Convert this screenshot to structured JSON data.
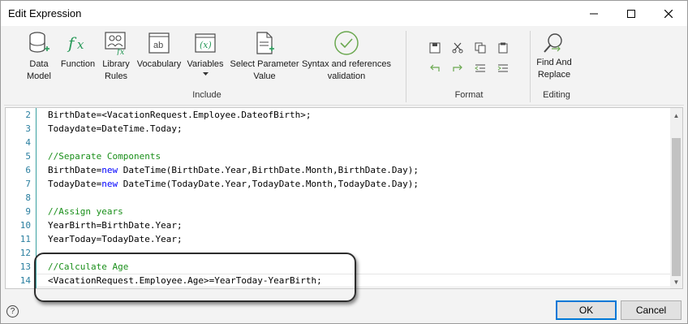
{
  "window": {
    "title": "Edit Expression"
  },
  "ribbon": {
    "include_group": {
      "label": "Include",
      "tools": [
        {
          "label": "Data\nModel"
        },
        {
          "label": "Function"
        },
        {
          "label": "Library\nRules"
        },
        {
          "label": "Vocabulary"
        },
        {
          "label": "Variables"
        },
        {
          "label": "Select Parameter\nValue"
        },
        {
          "label": "Syntax and references\nvalidation"
        }
      ]
    },
    "format_group": {
      "label": "Format"
    },
    "editing_group": {
      "label": "Editing",
      "tools": [
        {
          "label": "Find And\nReplace"
        }
      ]
    }
  },
  "editor": {
    "lines": [
      {
        "n": "2",
        "parts": [
          [
            "BirthDate=<VacationRequest.Employee.DateofBirth>;",
            "n"
          ]
        ]
      },
      {
        "n": "3",
        "parts": [
          [
            "Todaydate=DateTime.Today;",
            "n"
          ]
        ]
      },
      {
        "n": "4",
        "parts": []
      },
      {
        "n": "5",
        "parts": [
          [
            "//Separate Components",
            "c"
          ]
        ]
      },
      {
        "n": "6",
        "parts": [
          [
            "BirthDate=",
            "n"
          ],
          [
            "new",
            "k"
          ],
          [
            " DateTime(BirthDate.Year,BirthDate.Month,BirthDate.Day);",
            "n"
          ]
        ]
      },
      {
        "n": "7",
        "parts": [
          [
            "TodayDate=",
            "n"
          ],
          [
            "new",
            "k"
          ],
          [
            " DateTime(TodayDate.Year,TodayDate.Month,TodayDate.Day);",
            "n"
          ]
        ]
      },
      {
        "n": "8",
        "parts": []
      },
      {
        "n": "9",
        "parts": [
          [
            "//Assign years",
            "c"
          ]
        ]
      },
      {
        "n": "10",
        "parts": [
          [
            "YearBirth=BirthDate.Year;",
            "n"
          ]
        ]
      },
      {
        "n": "11",
        "parts": [
          [
            "YearToday=TodayDate.Year;",
            "n"
          ]
        ]
      },
      {
        "n": "12",
        "parts": []
      },
      {
        "n": "13",
        "parts": [
          [
            "//Calculate Age",
            "c"
          ]
        ]
      },
      {
        "n": "14",
        "parts": [
          [
            "<VacationRequest.Employee.Age>=YearToday-YearBirth;",
            "n"
          ]
        ]
      }
    ]
  },
  "footer": {
    "help_label": "?",
    "ok_label": "OK",
    "cancel_label": "Cancel"
  },
  "colors": {
    "keyword": "#0000ff",
    "comment": "#1a8f1a",
    "line_number": "#2b7fa0",
    "accent": "#0078d7"
  }
}
